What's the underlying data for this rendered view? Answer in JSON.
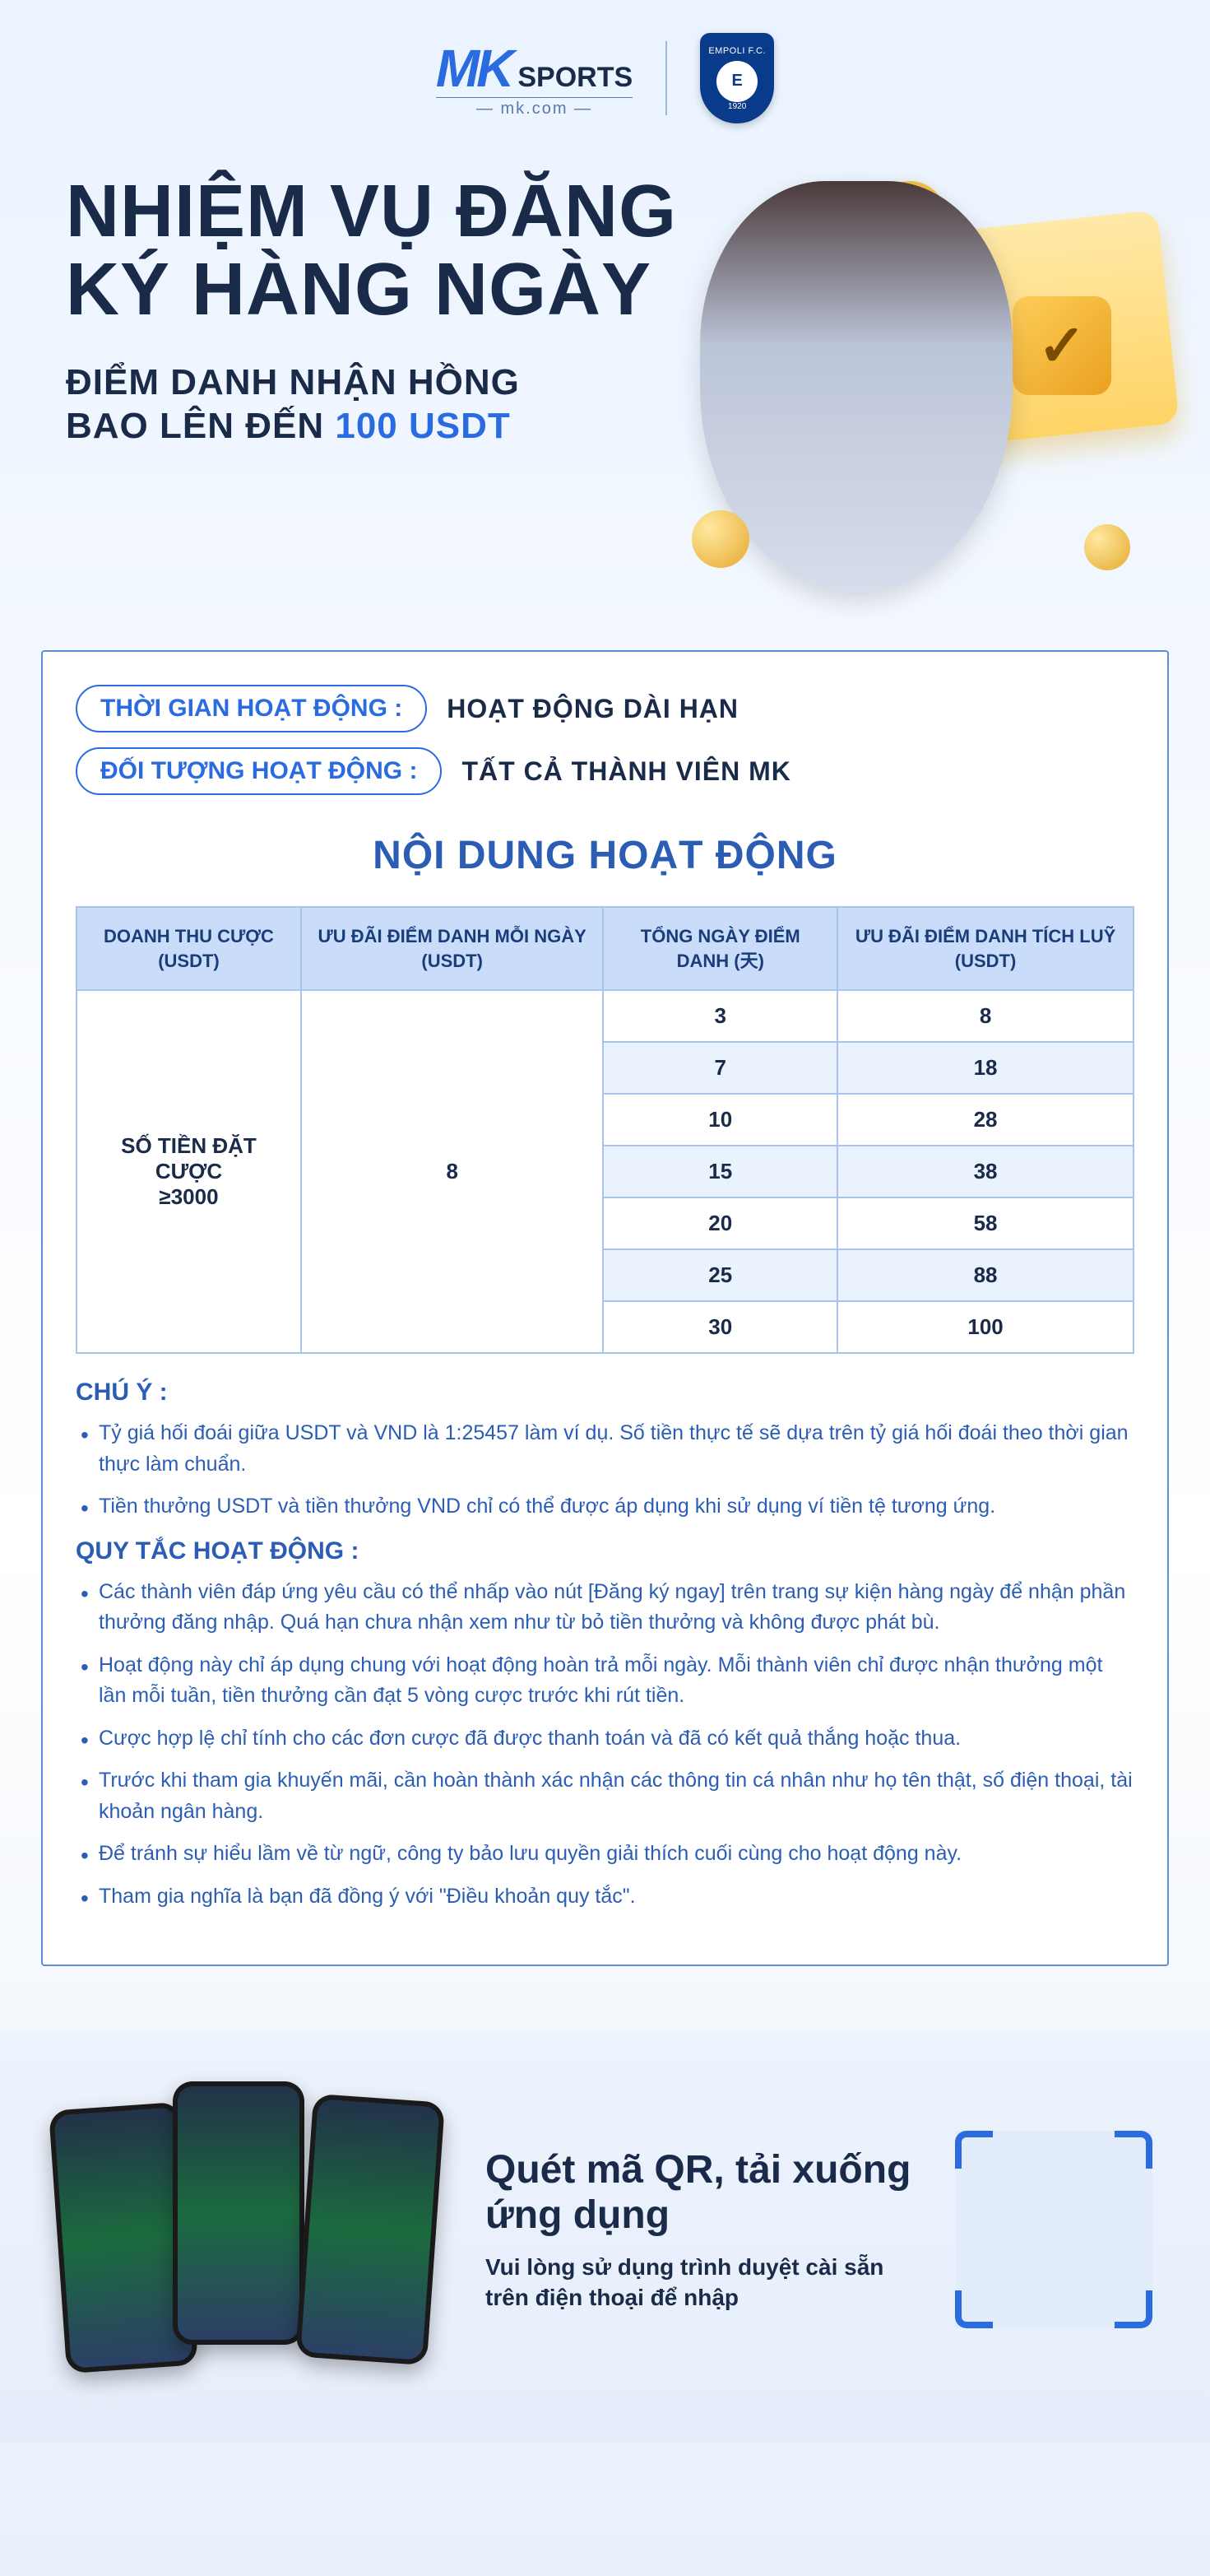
{
  "header": {
    "logo_prefix": "MK",
    "logo_word": "SPORTS",
    "logo_sub": "— mk.com —",
    "badge_top": "EMPOLI F.C.",
    "badge_letter": "E",
    "badge_year": "1920"
  },
  "hero": {
    "title": "NHIỆM VỤ ĐĂNG KÝ HÀNG NGÀY",
    "subtitle_a": "ĐIỂM DANH NHẬN HỒNG",
    "subtitle_b": "BAO LÊN ĐẾN ",
    "usdt": "100 USDT"
  },
  "info": {
    "label_time": "THỜI GIAN HOẠT ĐỘNG :",
    "value_time": "HOẠT ĐỘNG DÀI HẠN",
    "label_target": "ĐỐI TƯỢNG HOẠT ĐỘNG :",
    "value_target": "TẤT CẢ THÀNH VIÊN MK"
  },
  "section_title": "NỘI DUNG HOẠT ĐỘNG",
  "table": {
    "headers": {
      "c1": "DOANH THU CƯỢC (USDT)",
      "c2": "ƯU ĐÃI ĐIỂM DANH MỖI NGÀY (USDT)",
      "c3": "TỔNG NGÀY ĐIỂM DANH (天)",
      "c4": "ƯU ĐÃI ĐIỂM DANH TÍCH LUỸ (USDT)"
    },
    "span1_line1": "SỐ TIỀN ĐẶT CƯỢC",
    "span1_line2": "≥3000",
    "span2": "8",
    "rows": [
      {
        "days": "3",
        "bonus": "8"
      },
      {
        "days": "7",
        "bonus": "18"
      },
      {
        "days": "10",
        "bonus": "28"
      },
      {
        "days": "15",
        "bonus": "38"
      },
      {
        "days": "20",
        "bonus": "58"
      },
      {
        "days": "25",
        "bonus": "88"
      },
      {
        "days": "30",
        "bonus": "100"
      }
    ]
  },
  "notes": {
    "head": "CHÚ Ý :",
    "items": [
      "Tỷ giá hối đoái giữa USDT và VND là 1:25457 làm ví dụ. Số tiền thực tế sẽ dựa trên tỷ giá hối đoái theo thời gian thực làm chuẩn.",
      "Tiền thưởng USDT và tiền thưởng VND chỉ có thể được áp dụng khi sử dụng ví tiền tệ tương ứng."
    ]
  },
  "rules": {
    "head": "QUY TẮC HOẠT ĐỘNG :",
    "items": [
      "Các thành viên đáp ứng yêu cầu có thể nhấp vào nút [Đăng ký ngay] trên trang sự kiện hàng ngày để nhận phần thưởng đăng nhập. Quá hạn chưa nhận xem như từ bỏ tiền thưởng và không được phát bù.",
      "Hoạt động này chỉ áp dụng chung với hoạt động hoàn trả mỗi ngày. Mỗi thành viên chỉ được nhận thưởng một lần mỗi tuần, tiền thưởng cần đạt 5 vòng cược trước khi rút tiền.",
      "Cược hợp lệ chỉ tính cho các đơn cược đã được thanh toán và đã có kết quả thắng hoặc thua.",
      "Trước khi tham gia khuyến mãi, cần hoàn thành xác nhận các thông tin cá nhân như họ tên thật, số điện thoại, tài khoản ngân hàng.",
      "Để tránh sự hiểu lầm về từ ngữ, công ty bảo lưu quyền giải thích cuối cùng cho hoạt động này.",
      "Tham gia nghĩa là bạn đã đồng ý với \"Điều khoản quy tắc\"."
    ]
  },
  "footer": {
    "title": "Quét mã QR, tải xuống ứng dụng",
    "subtitle": "Vui lòng sử dụng trình duyệt cài sẵn trên điện thoại để nhập"
  },
  "colors": {
    "accent": "#2b6be0",
    "dark": "#1a2b4a",
    "table_header": "#c9ddfa"
  }
}
